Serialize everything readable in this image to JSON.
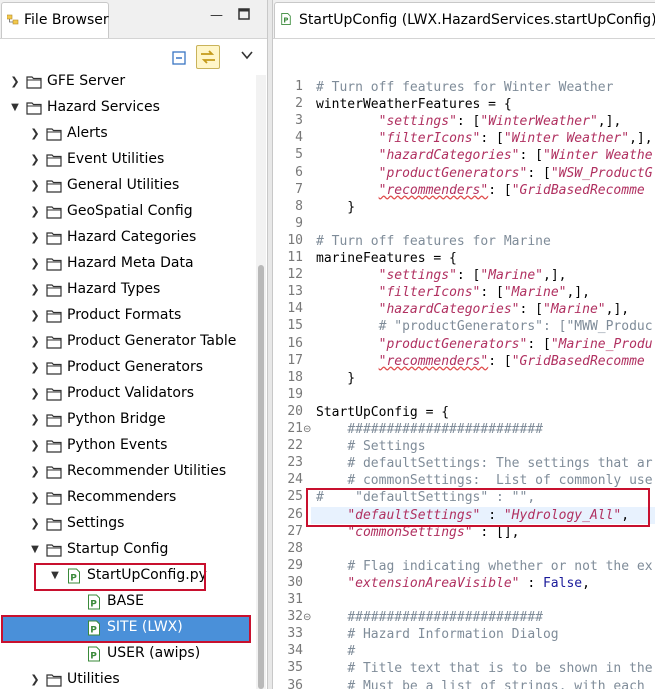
{
  "left_panel": {
    "tab_title": "File Browser",
    "tree": [
      {
        "label": "GFE Server",
        "depth": 1,
        "expanded": false,
        "icon": "folder-icon"
      },
      {
        "label": "Hazard Services",
        "depth": 1,
        "expanded": true,
        "icon": "folder-icon"
      },
      {
        "label": "Alerts",
        "depth": 2,
        "expanded": false,
        "icon": "folder-icon"
      },
      {
        "label": "Event Utilities",
        "depth": 2,
        "expanded": false,
        "icon": "folder-icon"
      },
      {
        "label": "General Utilities",
        "depth": 2,
        "expanded": false,
        "icon": "folder-icon"
      },
      {
        "label": "GeoSpatial Config",
        "depth": 2,
        "expanded": false,
        "icon": "folder-icon"
      },
      {
        "label": "Hazard Categories",
        "depth": 2,
        "expanded": false,
        "icon": "folder-icon"
      },
      {
        "label": "Hazard Meta Data",
        "depth": 2,
        "expanded": false,
        "icon": "folder-icon"
      },
      {
        "label": "Hazard Types",
        "depth": 2,
        "expanded": false,
        "icon": "folder-icon"
      },
      {
        "label": "Product Formats",
        "depth": 2,
        "expanded": false,
        "icon": "folder-icon"
      },
      {
        "label": "Product Generator Table",
        "depth": 2,
        "expanded": false,
        "icon": "folder-icon"
      },
      {
        "label": "Product Generators",
        "depth": 2,
        "expanded": false,
        "icon": "folder-icon"
      },
      {
        "label": "Product Validators",
        "depth": 2,
        "expanded": false,
        "icon": "folder-icon"
      },
      {
        "label": "Python Bridge",
        "depth": 2,
        "expanded": false,
        "icon": "folder-icon"
      },
      {
        "label": "Python Events",
        "depth": 2,
        "expanded": false,
        "icon": "folder-icon"
      },
      {
        "label": "Recommender Utilities",
        "depth": 2,
        "expanded": false,
        "icon": "folder-icon"
      },
      {
        "label": "Recommenders",
        "depth": 2,
        "expanded": false,
        "icon": "folder-icon"
      },
      {
        "label": "Settings",
        "depth": 2,
        "expanded": false,
        "icon": "folder-icon"
      },
      {
        "label": "Startup Config",
        "depth": 2,
        "expanded": true,
        "icon": "folder-icon"
      },
      {
        "label": "StartUpConfig.py",
        "depth": 3,
        "expanded": true,
        "icon": "python-file-icon"
      },
      {
        "label": "BASE",
        "depth": 4,
        "expanded": null,
        "icon": "python-file-icon"
      },
      {
        "label": "SITE (LWX)",
        "depth": 4,
        "expanded": null,
        "icon": "python-file-icon",
        "selected": true
      },
      {
        "label": "USER (awips)",
        "depth": 4,
        "expanded": null,
        "icon": "python-file-icon"
      },
      {
        "label": "Utilities",
        "depth": 2,
        "expanded": false,
        "icon": "folder-icon"
      }
    ]
  },
  "editor": {
    "tab_title": "StartUpConfig (LWX.HazardServices.startUpConfig)",
    "lines": [
      {
        "n": "1",
        "segs": [
          [
            "c",
            "# Turn off features for Winter Weather"
          ]
        ]
      },
      {
        "n": "2",
        "segs": [
          [
            "p",
            "winterWeatherFeatures = {"
          ]
        ]
      },
      {
        "n": "3",
        "segs": [
          [
            "p",
            "        "
          ],
          [
            "s",
            "\"settings\""
          ],
          [
            "p",
            ": ["
          ],
          [
            "s",
            "\"WinterWeather\""
          ],
          [
            "p",
            ",],"
          ]
        ]
      },
      {
        "n": "4",
        "segs": [
          [
            "p",
            "        "
          ],
          [
            "s",
            "\"filterIcons\""
          ],
          [
            "p",
            ": ["
          ],
          [
            "s",
            "\"Winter Weather\""
          ],
          [
            "p",
            ",],"
          ]
        ]
      },
      {
        "n": "5",
        "segs": [
          [
            "p",
            "        "
          ],
          [
            "s",
            "\"hazardCategories\""
          ],
          [
            "p",
            ": ["
          ],
          [
            "s",
            "\"Winter Weathe"
          ]
        ]
      },
      {
        "n": "6",
        "segs": [
          [
            "p",
            "        "
          ],
          [
            "s",
            "\"productGenerators\""
          ],
          [
            "p",
            ": ["
          ],
          [
            "s",
            "\"WSW_ProductG"
          ]
        ]
      },
      {
        "n": "7",
        "segs": [
          [
            "p",
            "        "
          ],
          [
            "q",
            "\"recommenders\""
          ],
          [
            "p",
            ": ["
          ],
          [
            "s",
            "\"GridBasedRecomme"
          ]
        ]
      },
      {
        "n": "8",
        "segs": [
          [
            "p",
            "    }"
          ]
        ]
      },
      {
        "n": "9",
        "segs": [
          [
            "p",
            ""
          ]
        ]
      },
      {
        "n": "10",
        "segs": [
          [
            "c",
            "# Turn off features for Marine"
          ]
        ]
      },
      {
        "n": "11",
        "segs": [
          [
            "p",
            "marineFeatures = {"
          ]
        ]
      },
      {
        "n": "12",
        "segs": [
          [
            "p",
            "        "
          ],
          [
            "s",
            "\"settings\""
          ],
          [
            "p",
            ": ["
          ],
          [
            "s",
            "\"Marine\""
          ],
          [
            "p",
            ",],"
          ]
        ]
      },
      {
        "n": "13",
        "segs": [
          [
            "p",
            "        "
          ],
          [
            "s",
            "\"filterIcons\""
          ],
          [
            "p",
            ": ["
          ],
          [
            "s",
            "\"Marine\""
          ],
          [
            "p",
            ",],"
          ]
        ]
      },
      {
        "n": "14",
        "segs": [
          [
            "p",
            "        "
          ],
          [
            "s",
            "\"hazardCategories\""
          ],
          [
            "p",
            ": ["
          ],
          [
            "s",
            "\"Marine\""
          ],
          [
            "p",
            ",],"
          ]
        ]
      },
      {
        "n": "15",
        "segs": [
          [
            "p",
            "        "
          ],
          [
            "c",
            "# \"productGenerators\": [\"MWW_Produc"
          ]
        ]
      },
      {
        "n": "16",
        "segs": [
          [
            "p",
            "        "
          ],
          [
            "s",
            "\"productGenerators\""
          ],
          [
            "p",
            ": ["
          ],
          [
            "s",
            "\"Marine_Produ"
          ]
        ]
      },
      {
        "n": "17",
        "segs": [
          [
            "p",
            "        "
          ],
          [
            "q",
            "\"recommenders\""
          ],
          [
            "p",
            ": ["
          ],
          [
            "s",
            "\"GridBasedRecomme"
          ]
        ]
      },
      {
        "n": "18",
        "segs": [
          [
            "p",
            "    }"
          ]
        ]
      },
      {
        "n": "19",
        "segs": [
          [
            "p",
            ""
          ]
        ]
      },
      {
        "n": "20",
        "segs": [
          [
            "p",
            "StartUpConfig = {"
          ]
        ]
      },
      {
        "n": "21",
        "segs": [
          [
            "p",
            "    "
          ],
          [
            "c",
            "#########################"
          ]
        ],
        "fold": true
      },
      {
        "n": "22",
        "segs": [
          [
            "p",
            "    "
          ],
          [
            "c",
            "# Settings"
          ]
        ]
      },
      {
        "n": "23",
        "segs": [
          [
            "p",
            "    "
          ],
          [
            "c",
            "# defaultSettings: The settings that ar"
          ]
        ]
      },
      {
        "n": "24",
        "segs": [
          [
            "p",
            "    "
          ],
          [
            "c",
            "# commonSettings:  List of commonly use"
          ]
        ]
      },
      {
        "n": "25",
        "segs": [
          [
            "c",
            "#    \"defaultSettings\" : \"\","
          ]
        ]
      },
      {
        "n": "26",
        "segs": [
          [
            "p",
            "    "
          ],
          [
            "s",
            "\"defaultSettings\""
          ],
          [
            "p",
            " : "
          ],
          [
            "s",
            "\"Hydrology_All\""
          ],
          [
            "p",
            ","
          ]
        ],
        "highlight": true
      },
      {
        "n": "27",
        "segs": [
          [
            "p",
            "    "
          ],
          [
            "s",
            "\"commonSettings\""
          ],
          [
            "p",
            " : [],"
          ]
        ]
      },
      {
        "n": "28",
        "segs": [
          [
            "p",
            ""
          ]
        ]
      },
      {
        "n": "29",
        "segs": [
          [
            "p",
            "    "
          ],
          [
            "c",
            "# Flag indicating whether or not the ex"
          ]
        ]
      },
      {
        "n": "30",
        "segs": [
          [
            "p",
            "    "
          ],
          [
            "s",
            "\"extensionAreaVisible\""
          ],
          [
            "p",
            " : "
          ],
          [
            "k",
            "False"
          ],
          [
            "p",
            ","
          ]
        ]
      },
      {
        "n": "31",
        "segs": [
          [
            "p",
            ""
          ]
        ]
      },
      {
        "n": "32",
        "segs": [
          [
            "p",
            "    "
          ],
          [
            "c",
            "#########################"
          ]
        ],
        "fold": true
      },
      {
        "n": "33",
        "segs": [
          [
            "p",
            "    "
          ],
          [
            "c",
            "# Hazard Information Dialog"
          ]
        ]
      },
      {
        "n": "34",
        "segs": [
          [
            "p",
            "    "
          ],
          [
            "c",
            "#"
          ]
        ]
      },
      {
        "n": "35",
        "segs": [
          [
            "p",
            "    "
          ],
          [
            "c",
            "# Title text that is to be shown in the"
          ]
        ]
      },
      {
        "n": "36",
        "segs": [
          [
            "p",
            "    "
          ],
          [
            "c",
            "# Must be a list of strings, with each"
          ]
        ]
      },
      {
        "n": "37",
        "segs": [
          [
            "p",
            "    "
          ],
          [
            "c",
            "#"
          ]
        ]
      },
      {
        "n": "38",
        "segs": [
          [
            "p",
            "    "
          ],
          [
            "c",
            "#    eventID        Event identifier."
          ]
        ]
      },
      {
        "n": "39",
        "segs": [
          [
            "p",
            "    "
          ],
          [
            "c",
            "#    hazardType     Hazard type, for e"
          ]
        ]
      }
    ]
  },
  "colors": {
    "selection": "#4a90d9",
    "annotation_box": "#c8102e",
    "string": "#b03060",
    "comment": "#7f8c99"
  }
}
